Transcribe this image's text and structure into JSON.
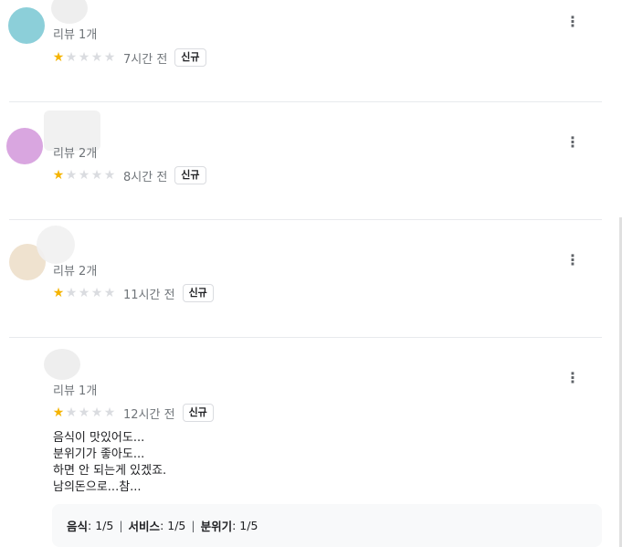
{
  "reviews": [
    {
      "count": "리뷰 1개",
      "stars": 1,
      "time": "7시간 전",
      "badge": "신규",
      "avatar_color": "#8ccfd9"
    },
    {
      "count": "리뷰 2개",
      "stars": 1,
      "time": "8시간 전",
      "badge": "신규",
      "avatar_color": "#d9a6e0"
    },
    {
      "count": "리뷰 2개",
      "stars": 1,
      "time": "11시간 전",
      "badge": "신규",
      "avatar_color": "#efe2cf"
    },
    {
      "count": "리뷰 1개",
      "stars": 1,
      "time": "12시간 전",
      "badge": "신규",
      "text_lines": [
        "음식이 맛있어도...",
        "분위기가 좋아도...",
        "하면 안 되는게 있겠죠.",
        "남의돈으로...참..."
      ],
      "details": {
        "food_label": "음식",
        "food_value": "1/5",
        "service_label": "서비스",
        "service_value": "1/5",
        "atmosphere_label": "분위기",
        "atmosphere_value": "1/5"
      }
    }
  ],
  "more_icon": "⋮",
  "star_glyph": "★",
  "colors": {
    "star_on": "#f5b400",
    "star_off": "#dadce0"
  }
}
